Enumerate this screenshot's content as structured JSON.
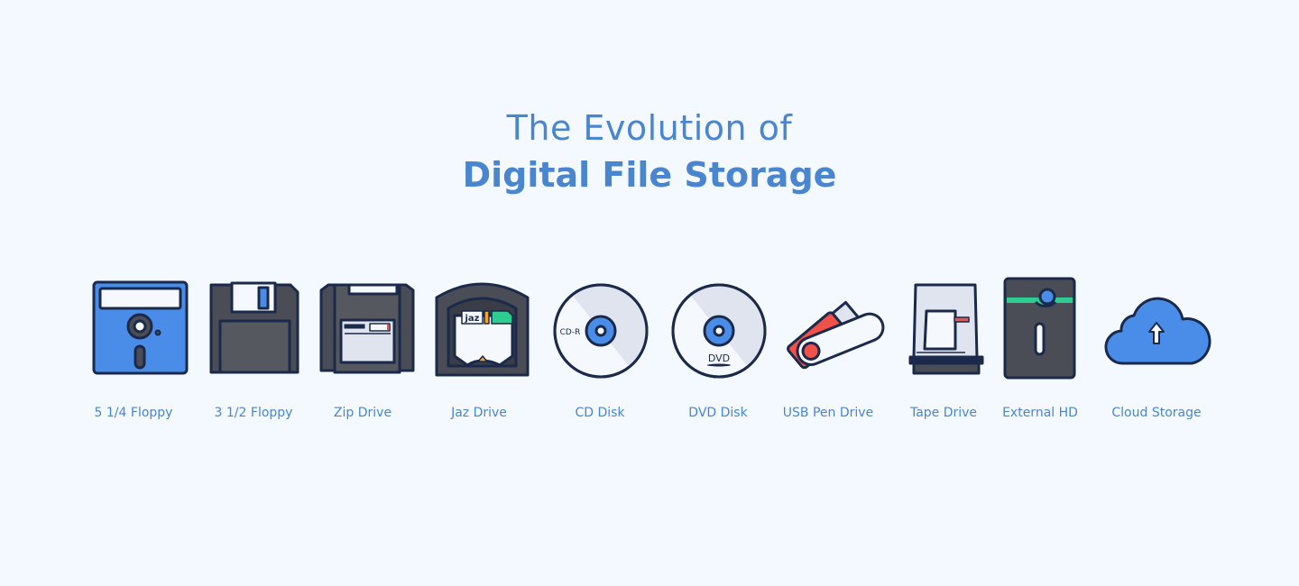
{
  "title": {
    "line1": "The Evolution of",
    "line2": "Digital File Storage"
  },
  "colors": {
    "background": "#f3f9fe",
    "accent": "#4a86d0",
    "outline": "#1b2a4a",
    "dark": "#4a4d55",
    "blue": "#4a8de8",
    "red": "#f0524a",
    "green": "#2ecc8e",
    "orange": "#f5a623"
  },
  "items": [
    {
      "label": "5 1/4 Floppy",
      "icon": "floppy-5-25-icon"
    },
    {
      "label": "3 1/2 Floppy",
      "icon": "floppy-3-5-icon"
    },
    {
      "label": "Zip Drive",
      "icon": "zip-disk-icon"
    },
    {
      "label": "Jaz Drive",
      "icon": "jaz-disk-icon",
      "icon_text": "jaz"
    },
    {
      "label": "CD Disk",
      "icon": "cd-icon",
      "icon_text": "CD-R"
    },
    {
      "label": "DVD Disk",
      "icon": "dvd-icon",
      "icon_text": "DVD"
    },
    {
      "label": "USB Pen Drive",
      "icon": "usb-drive-icon"
    },
    {
      "label": "Tape Drive",
      "icon": "tape-drive-icon"
    },
    {
      "label": "External HD",
      "icon": "external-hd-icon"
    },
    {
      "label": "Cloud Storage",
      "icon": "cloud-upload-icon"
    }
  ]
}
